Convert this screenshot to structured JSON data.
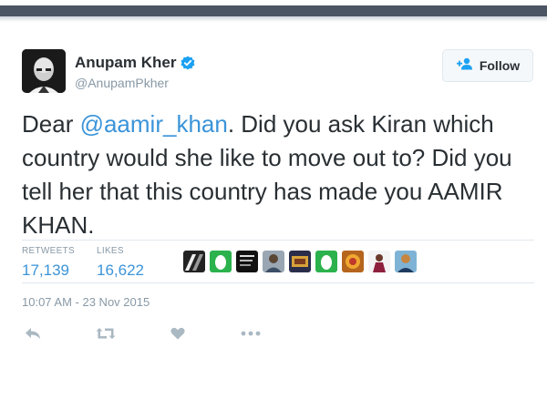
{
  "author": {
    "display_name": "Anupam Kher",
    "handle": "@AnupamPkher",
    "verified_icon": "verified-badge-icon"
  },
  "follow": {
    "label": "Follow",
    "icon": "add-user-icon"
  },
  "tweet": {
    "text_before": "Dear ",
    "mention": "@aamir_khan",
    "text_after": ". Did you ask Kiran which country would she like to move out to? Did you tell her that this country has made you AAMIR KHAN."
  },
  "stats": {
    "retweets_label": "RETWEETS",
    "retweets_value": "17,139",
    "likes_label": "LIKES",
    "likes_value": "16,622"
  },
  "timestamp": "10:07 AM - 23 Nov 2015",
  "actions": [
    "reply-icon",
    "retweet-icon",
    "like-icon",
    "more-icon"
  ],
  "colors": {
    "accent": "#3b94d9",
    "text": "#292f33",
    "muted": "#8899a6",
    "border": "#e1e8ed",
    "verified": "#1da1f2"
  }
}
